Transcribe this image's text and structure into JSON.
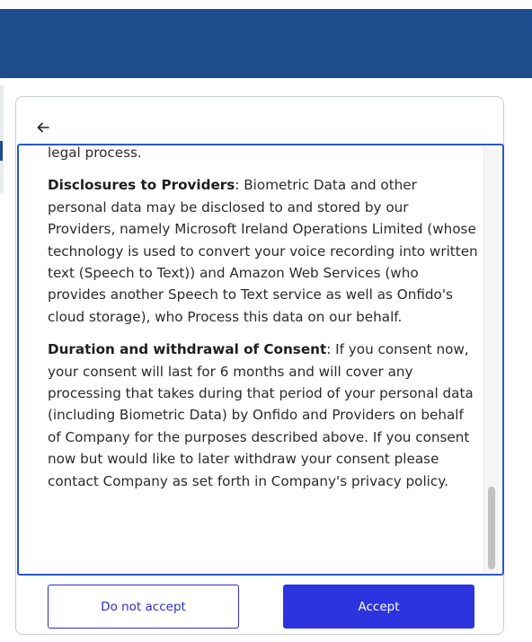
{
  "colors": {
    "header_bar": "#1f4e8f",
    "focus_border": "#2b57c6",
    "primary_button": "#2c34e0",
    "secondary_button_border": "#2b2fc7"
  },
  "icons": {
    "back": "arrow-left-icon"
  },
  "consent": {
    "partial_paragraph": "legal process.",
    "disclosures_heading": "Disclosures to Providers",
    "disclosures_text": ": Biometric Data and other personal data may be disclosed to and stored by our Providers, namely Microsoft Ireland Operations Limited (whose technology is used to convert your voice recording into written text (Speech to Text)) and Amazon Web Services (who provides another Speech to Text service as well as Onfido's cloud storage), who Process this data on our behalf.",
    "duration_heading": "Duration and withdrawal of Consent",
    "duration_text": ": If you consent now, your consent will last for 6 months and will cover any processing that takes during that period of your personal data (including Biometric Data) by Onfido and Providers on behalf of Company for the purposes described above. If you consent now but would like to later withdraw your consent please contact Company as set forth in Company's privacy policy."
  },
  "scroll": {
    "thumb_position_fraction": 0.8
  },
  "actions": {
    "decline_label": "Do not accept",
    "accept_label": "Accept"
  }
}
